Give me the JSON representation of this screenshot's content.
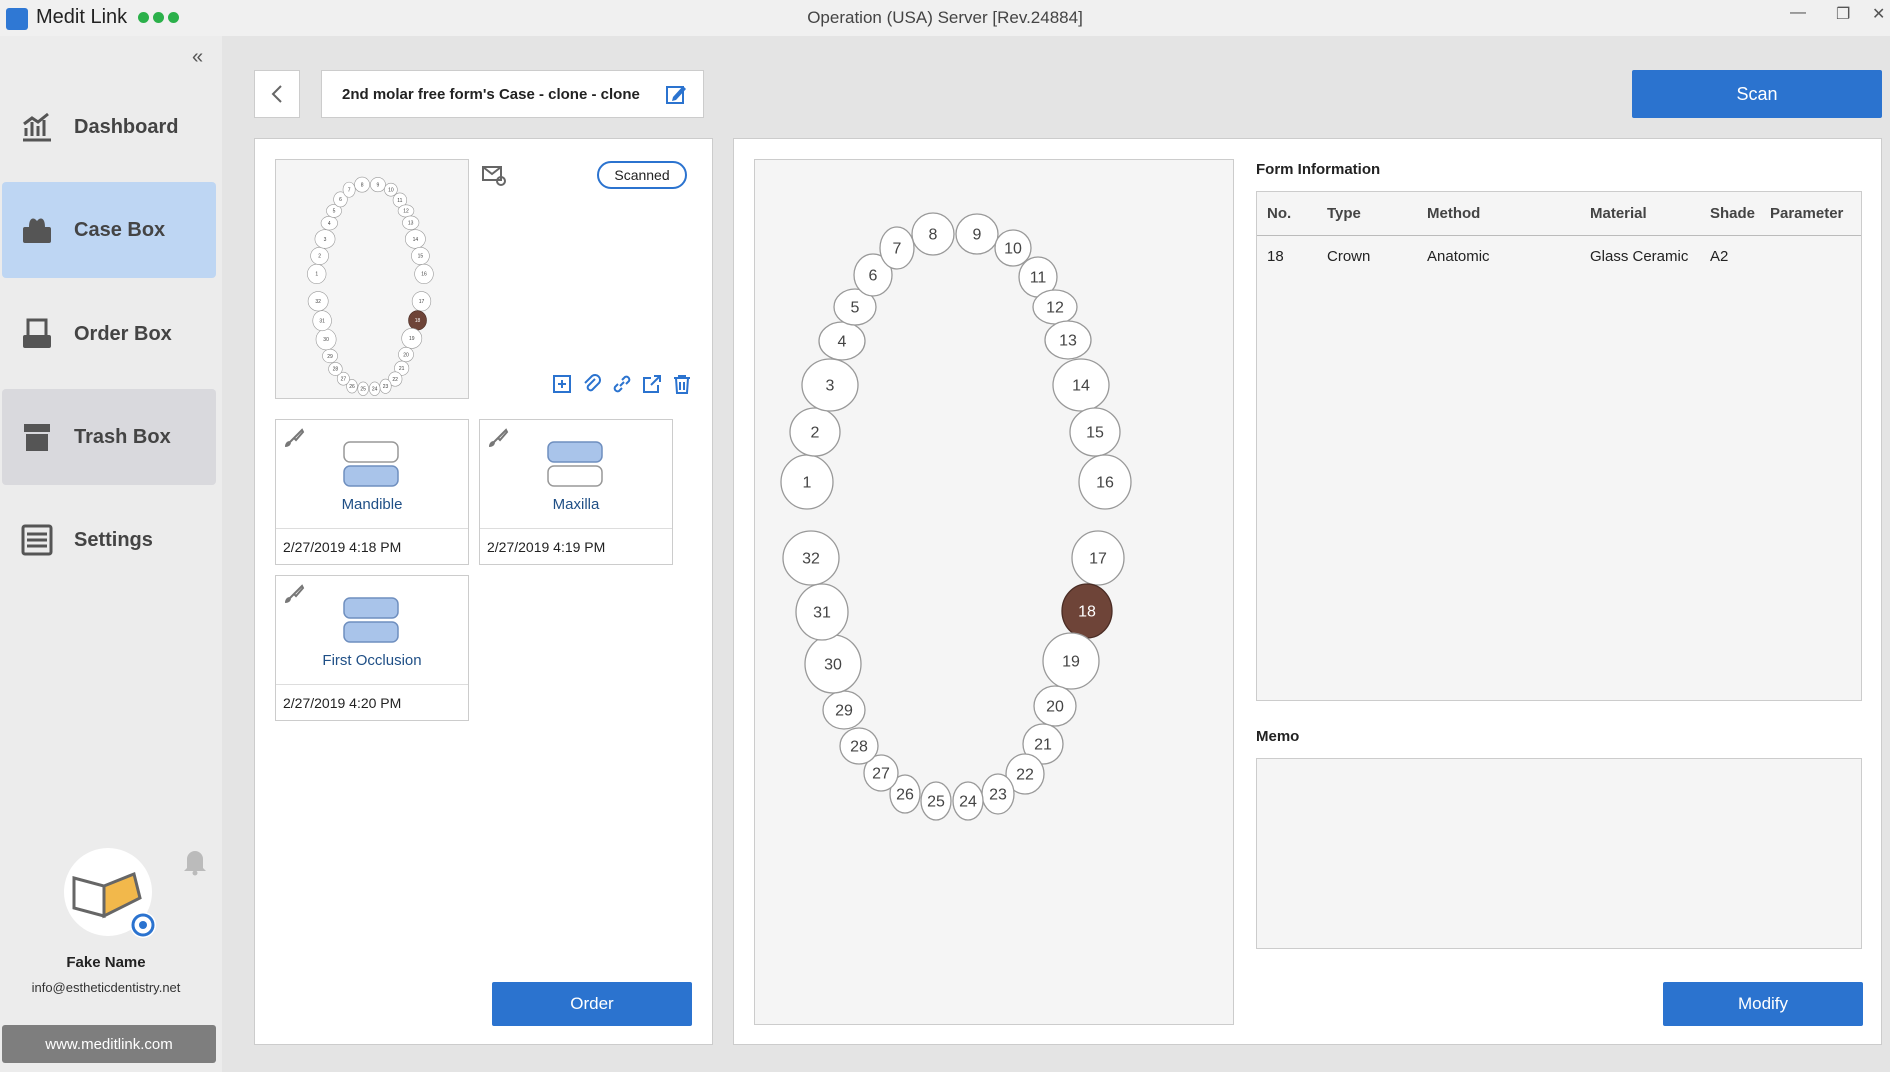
{
  "app": {
    "name": "Medit Link",
    "window_title": "Operation (USA) Server [Rev.24884]"
  },
  "sidebar": {
    "collapse_icon": "double-chevron-left-icon",
    "items": [
      {
        "label": "Dashboard",
        "icon": "dashboard-icon"
      },
      {
        "label": "Case Box",
        "icon": "case-box-icon",
        "active": true
      },
      {
        "label": "Order Box",
        "icon": "order-box-icon"
      },
      {
        "label": "Trash Box",
        "icon": "trash-box-icon"
      },
      {
        "label": "Settings",
        "icon": "settings-icon"
      }
    ],
    "user": {
      "name": "Fake Name",
      "email": "info@estheticdentistry.net"
    },
    "website": "www.meditlink.com"
  },
  "header": {
    "case_title": "2nd molar free form's Case - clone - clone",
    "scan_label": "Scan"
  },
  "left_panel": {
    "status": "Scanned",
    "scans": [
      {
        "label": "Mandible",
        "date": "2/27/2019 4:18 PM"
      },
      {
        "label": "Maxilla",
        "date": "2/27/2019 4:19 PM"
      },
      {
        "label": "First Occlusion",
        "date": "2/27/2019 4:20 PM"
      }
    ],
    "order_label": "Order"
  },
  "tooth_chart": {
    "selected": [
      "18"
    ],
    "selected_color": "#6e4438"
  },
  "form_info": {
    "title": "Form Information",
    "headers": [
      "No.",
      "Type",
      "Method",
      "Material",
      "Shade",
      "Parameter"
    ],
    "rows": [
      {
        "no": "18",
        "type": "Crown",
        "method": "Anatomic",
        "material": "Glass Ceramic",
        "shade": "A2",
        "parameter": ""
      }
    ]
  },
  "memo": {
    "title": "Memo",
    "text": ""
  },
  "modify_label": "Modify",
  "accent_color": "#2b73cf"
}
